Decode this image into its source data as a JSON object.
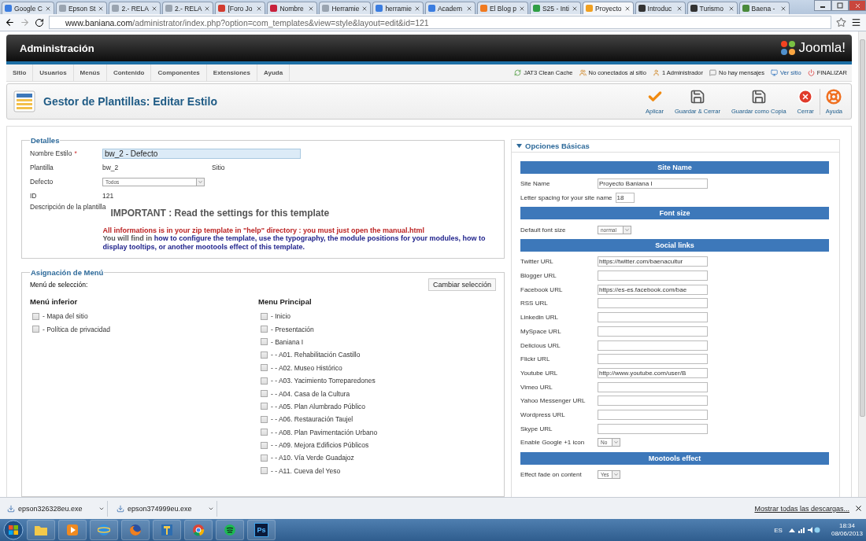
{
  "browser": {
    "tabs": [
      {
        "label": "Google C",
        "selected": false,
        "color": "#3b7de0"
      },
      {
        "label": "Epson St",
        "selected": false,
        "color": "#9aa4b0"
      },
      {
        "label": "2.- RELA",
        "selected": false,
        "color": "#9aa4b0"
      },
      {
        "label": "2.- RELA",
        "selected": false,
        "color": "#9aa4b0"
      },
      {
        "label": "[Foro Jo",
        "selected": false,
        "color": "#d23b2f"
      },
      {
        "label": "Nombre",
        "selected": false,
        "color": "#c8203c"
      },
      {
        "label": "Herramie",
        "selected": false,
        "color": "#9aa4b0"
      },
      {
        "label": "herramie",
        "selected": false,
        "color": "#3b7de0"
      },
      {
        "label": "Academ",
        "selected": false,
        "color": "#3b7de0"
      },
      {
        "label": "El Blog p",
        "selected": false,
        "color": "#f07a20"
      },
      {
        "label": "S25 - Inti",
        "selected": false,
        "color": "#2f9e44"
      },
      {
        "label": "Proyecto",
        "selected": true,
        "color": "#f0a020"
      },
      {
        "label": "Introduc",
        "selected": false,
        "color": "#333333"
      },
      {
        "label": "Turismo",
        "selected": false,
        "color": "#333333"
      },
      {
        "label": "Baena -",
        "selected": false,
        "color": "#4a8a3a"
      }
    ],
    "url_host": "www.baniana.com",
    "url_path": "/administrator/index.php?option=com_templates&view=style&layout=edit&id=121"
  },
  "header": {
    "title": "Administración",
    "logo": "Joomla!"
  },
  "nav": [
    "Sitio",
    "Usuarios",
    "Menús",
    "Contenido",
    "Componentes",
    "Extensiones",
    "Ayuda"
  ],
  "status": [
    {
      "kind": "cache",
      "label": "JAT3 Clean Cache"
    },
    {
      "kind": "visitors",
      "label": "No conectados al sitio"
    },
    {
      "kind": "admins",
      "label": "1 Administrador"
    },
    {
      "kind": "messages",
      "label": "No hay mensajes"
    },
    {
      "kind": "site",
      "label": "Ver sitio"
    },
    {
      "kind": "logout",
      "label": "FINALIZAR"
    }
  ],
  "toolbar": {
    "title": "Gestor de Plantillas: Editar Estilo",
    "buttons": [
      {
        "kind": "apply",
        "label": "Aplicar"
      },
      {
        "kind": "save",
        "label": "Guardar & Cerrar"
      },
      {
        "kind": "save",
        "label": "Guardar como Copia"
      },
      {
        "kind": "close",
        "label": "Cerrar"
      },
      {
        "kind": "help",
        "label": "Ayuda"
      }
    ]
  },
  "details": {
    "legend": "Detalles",
    "style_name_label": "Nombre Estilo",
    "required_mark": "*",
    "style_name": "bw_2 - Defecto",
    "template_label": "Plantilla",
    "template": "bw_2",
    "client": "Sitio",
    "default_label": "Defecto",
    "default": "Todos",
    "id_label": "ID",
    "id": "121",
    "description_label": "Descripción de la plantilla",
    "description": {
      "heading": "IMPORTANT : Read the settings for this template",
      "warning": "All informations is in your zip template in \"help\" directory : you must just open the manual.html",
      "intro": "You will find in",
      "highlight": "how to configure the template, use the typography, the module positions for your modules, how to display tooltips, or another mootools effect of this template."
    }
  },
  "menu_assignment": {
    "legend": "Asignación de Menú",
    "selection_label": "Menú de selección:",
    "toggle_button": "Cambiar selección",
    "menus": [
      {
        "title": "Menú inferior",
        "items": [
          {
            "label": "- Mapa del sitio",
            "checked": false
          },
          {
            "label": "- Política de privacidad",
            "checked": false
          }
        ]
      },
      {
        "title": "Menu Principal",
        "items": [
          {
            "label": "- Inicio",
            "checked": false
          },
          {
            "label": "- Presentación",
            "checked": false
          },
          {
            "label": "- Baniana I",
            "checked": false
          },
          {
            "label": "- - A01. Rehabilitación Castillo",
            "checked": false
          },
          {
            "label": "- - A02. Museo Histórico",
            "checked": false
          },
          {
            "label": "- - A03. Yacimiento Torreparedones",
            "checked": false
          },
          {
            "label": "- - A04. Casa de la Cultura",
            "checked": false
          },
          {
            "label": "- - A05. Plan Alumbrado Público",
            "checked": false
          },
          {
            "label": "- - A06. Restauración Taujel",
            "checked": false
          },
          {
            "label": "- - A08. Plan Pavimentación Urbano",
            "checked": false
          },
          {
            "label": "- - A09. Mejora Edificios Públicos",
            "checked": false
          },
          {
            "label": "- - A10. Vía Verde Guadajoz",
            "checked": false
          },
          {
            "label": "- - A11. Cueva del Yeso",
            "checked": false
          }
        ]
      }
    ]
  },
  "options": {
    "title": "Opciones Básicas",
    "expanded": true,
    "rows": [
      {
        "kind": "header",
        "label": "Site Name"
      },
      {
        "kind": "text",
        "label": "Site Name",
        "value": "Proyecto Baniana I"
      },
      {
        "kind": "inline",
        "label": "Letter spacing for your site name",
        "value": "18"
      },
      {
        "kind": "header",
        "label": "Font size"
      },
      {
        "kind": "select",
        "label": "Default font size",
        "value": "normal"
      },
      {
        "kind": "header",
        "label": "Social links"
      },
      {
        "kind": "text",
        "label": "Twitter URL",
        "value": "https://twitter.com/baenacultur"
      },
      {
        "kind": "text",
        "label": "Blogger URL"
      },
      {
        "kind": "text",
        "label": "Facebook URL",
        "value": "https://es-es.facebook.com/bae"
      },
      {
        "kind": "text",
        "label": "RSS URL"
      },
      {
        "kind": "text",
        "label": "Linkedin URL"
      },
      {
        "kind": "text",
        "label": "MySpace URL"
      },
      {
        "kind": "text",
        "label": "Delicious URL"
      },
      {
        "kind": "text",
        "label": "Flickr URL"
      },
      {
        "kind": "text",
        "label": "Youtube URL",
        "value": "http://www.youtube.com/user/B"
      },
      {
        "kind": "text",
        "label": "Vimeo URL"
      },
      {
        "kind": "text",
        "label": "Yahoo Messenger URL"
      },
      {
        "kind": "text",
        "label": "Wordpress URL"
      },
      {
        "kind": "text",
        "label": "Skype URL"
      },
      {
        "kind": "select",
        "label": "Enable Google +1 icon",
        "value": "No"
      },
      {
        "kind": "header",
        "label": "Mootools effect"
      },
      {
        "kind": "select",
        "label": "Effect fade on content",
        "value": "Yes"
      }
    ]
  },
  "downloads": {
    "items": [
      "epson326328eu.exe",
      "epson374999eu.exe"
    ],
    "show_all": "Mostrar todas las descargas..."
  },
  "taskbar": {
    "app_label": "Ps",
    "language": "ES",
    "time": "18:34",
    "date": "08/06/2013"
  }
}
